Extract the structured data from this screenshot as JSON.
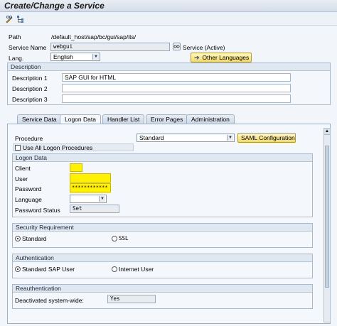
{
  "window": {
    "title": "Create/Change a Service"
  },
  "toolbar": {
    "icons": [
      "pencil-glasses-icon",
      "hierarchy-icon"
    ]
  },
  "header": {
    "path_label": "Path",
    "path_value": "/default_host/sap/bc/gui/sap/its/",
    "service_name_label": "Service Name",
    "service_name_value": "webgui",
    "service_status": "Service (Active)",
    "lang_label": "Lang.",
    "lang_value": "English",
    "other_languages_button": "Other Languages"
  },
  "description": {
    "title": "Description",
    "rows": [
      {
        "label": "Description 1",
        "value": "SAP GUI for HTML"
      },
      {
        "label": "Description 2",
        "value": ""
      },
      {
        "label": "Description 3",
        "value": ""
      }
    ]
  },
  "tabs": [
    {
      "label": "Service Data",
      "active": false
    },
    {
      "label": "Logon Data",
      "active": true
    },
    {
      "label": "Handler List",
      "active": false
    },
    {
      "label": "Error Pages",
      "active": false
    },
    {
      "label": "Administration",
      "active": false
    }
  ],
  "logon": {
    "procedure_label": "Procedure",
    "procedure_value": "Standard",
    "saml_button": "SAML Configuration",
    "use_all_label": "Use All Logon Procedures",
    "logon_data_title": "Logon Data",
    "client_label": "Client",
    "client_value": "",
    "user_label": "User",
    "user_value": "",
    "password_label": "Password",
    "password_value": "************",
    "language_label": "Language",
    "language_value": "",
    "password_status_label": "Password Status",
    "password_status_value": "Set"
  },
  "security": {
    "title": "Security Requirement",
    "option_standard": "Standard",
    "option_ssl": "SSL",
    "selected": "Standard"
  },
  "authentication": {
    "title": "Authentication",
    "option_standard_sap_user": "Standard SAP User",
    "option_internet_user": "Internet User",
    "selected": "Standard SAP User"
  },
  "reauthentication": {
    "title": "Reauthentication",
    "deactivated_label": "Deactivated system-wide:",
    "deactivated_value": "Yes"
  },
  "colors": {
    "highlight": "#fff200",
    "button": "#f1d863",
    "group_header": "#dfe7f1"
  }
}
